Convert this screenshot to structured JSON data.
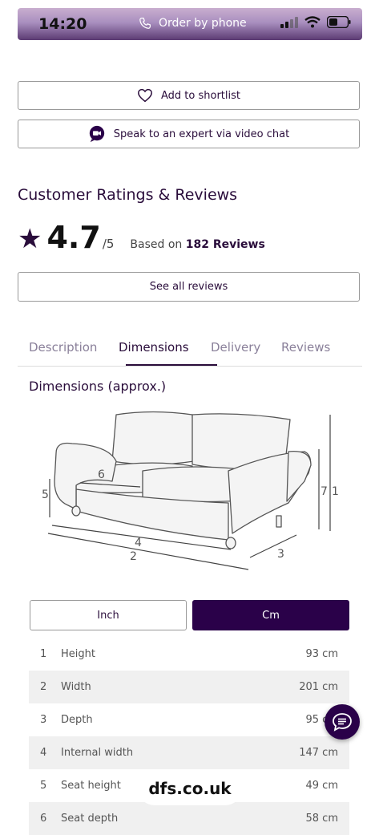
{
  "status_bar": {
    "time": "14:20",
    "order_label": "Order by phone",
    "icons": [
      "phone-icon",
      "signal-icon",
      "wifi-icon",
      "battery-icon"
    ]
  },
  "actions": {
    "shortlist_label": "Add to shortlist",
    "video_chat_label": "Speak to an expert via video chat"
  },
  "reviews": {
    "title": "Customer Ratings & Reviews",
    "rating": "4.7",
    "max": "/5",
    "based_on": "Based on",
    "count": "182 Reviews",
    "see_all_label": "See all reviews"
  },
  "tabs": [
    {
      "label": "Description",
      "active": false
    },
    {
      "label": "Dimensions",
      "active": true
    },
    {
      "label": "Delivery",
      "active": false
    },
    {
      "label": "Reviews",
      "active": false
    }
  ],
  "dimensions": {
    "title": "Dimensions (approx.)",
    "diagram_labels": [
      "1",
      "2",
      "3",
      "4",
      "5",
      "6",
      "7"
    ],
    "unit_inch": "Inch",
    "unit_cm": "Cm",
    "selected_unit": "Cm",
    "rows": [
      {
        "num": "1",
        "label": "Height",
        "value": "93 cm"
      },
      {
        "num": "2",
        "label": "Width",
        "value": "201 cm"
      },
      {
        "num": "3",
        "label": "Depth",
        "value": "95 cm"
      },
      {
        "num": "4",
        "label": "Internal width",
        "value": "147 cm"
      },
      {
        "num": "5",
        "label": "Seat height",
        "value": "49 cm"
      },
      {
        "num": "6",
        "label": "Seat depth",
        "value": "58 cm"
      }
    ]
  },
  "browser": {
    "url": "dfs.co.uk"
  },
  "colors": {
    "brand": "#2a0149",
    "accent": "#2a0d3b"
  }
}
